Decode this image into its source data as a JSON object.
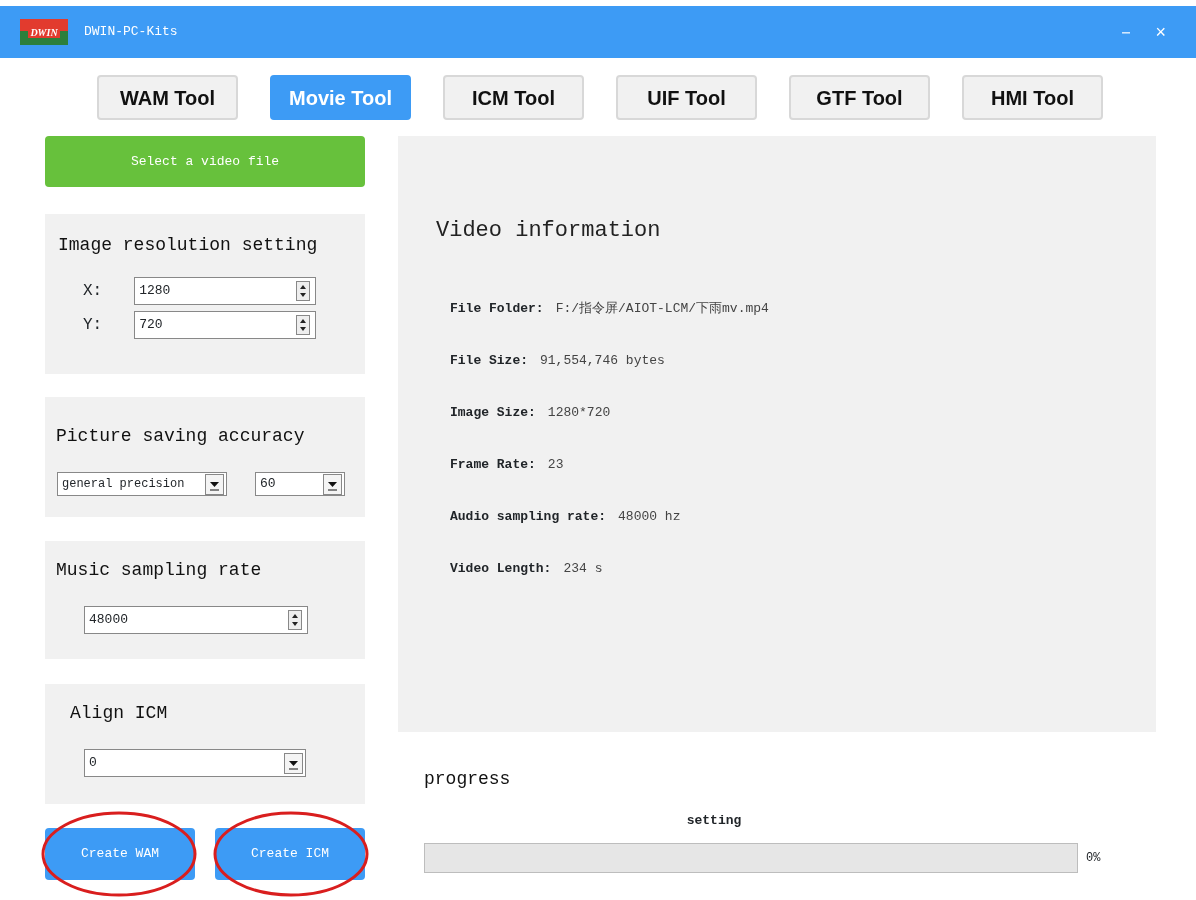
{
  "window": {
    "title": "DWIN-PC-Kits",
    "logo_text": "DWIN",
    "controls": [
      "－",
      "×"
    ]
  },
  "tabs": [
    {
      "label": "WAM Tool",
      "selected": false
    },
    {
      "label": "Movie Tool",
      "selected": true
    },
    {
      "label": "ICM Tool",
      "selected": false
    },
    {
      "label": "UIF Tool",
      "selected": false
    },
    {
      "label": "GTF Tool",
      "selected": false
    },
    {
      "label": "HMI Tool",
      "selected": false
    }
  ],
  "select_button": "Select a video file",
  "settings": [
    {
      "title": "Image resolution setting",
      "kind": "resolution",
      "fields": [
        {
          "label": "X:",
          "value": "1280"
        },
        {
          "label": "Y:",
          "value": "720"
        }
      ]
    },
    {
      "title": "Picture saving accuracy",
      "kind": "dropdowns",
      "fields": [
        {
          "value": "general precision"
        },
        {
          "value": "60"
        }
      ]
    },
    {
      "title": "Music sampling rate",
      "kind": "spin",
      "fields": [
        {
          "value": "48000"
        }
      ]
    },
    {
      "title": "Align ICM",
      "kind": "dropdown",
      "fields": [
        {
          "value": "0"
        }
      ]
    }
  ],
  "actions": [
    {
      "label": "Create WAM",
      "circled": true
    },
    {
      "label": "Create ICM",
      "circled": true
    }
  ],
  "video_info": {
    "title": "Video information",
    "rows": [
      {
        "label": "File Folder:",
        "value": "F:/指令屏/AIOT-LCM/下雨mv.mp4"
      },
      {
        "label": "File Size:",
        "value": "91,554,746 bytes"
      },
      {
        "label": "Image Size:",
        "value": "1280*720"
      },
      {
        "label": "Frame Rate:",
        "value": "23"
      },
      {
        "label": "Audio sampling rate:",
        "value": "48000 hz"
      },
      {
        "label": "Video Length:",
        "value": "234 s"
      }
    ]
  },
  "progress": {
    "title": "progress",
    "status": "setting",
    "level": 0,
    "reading": "0%"
  }
}
